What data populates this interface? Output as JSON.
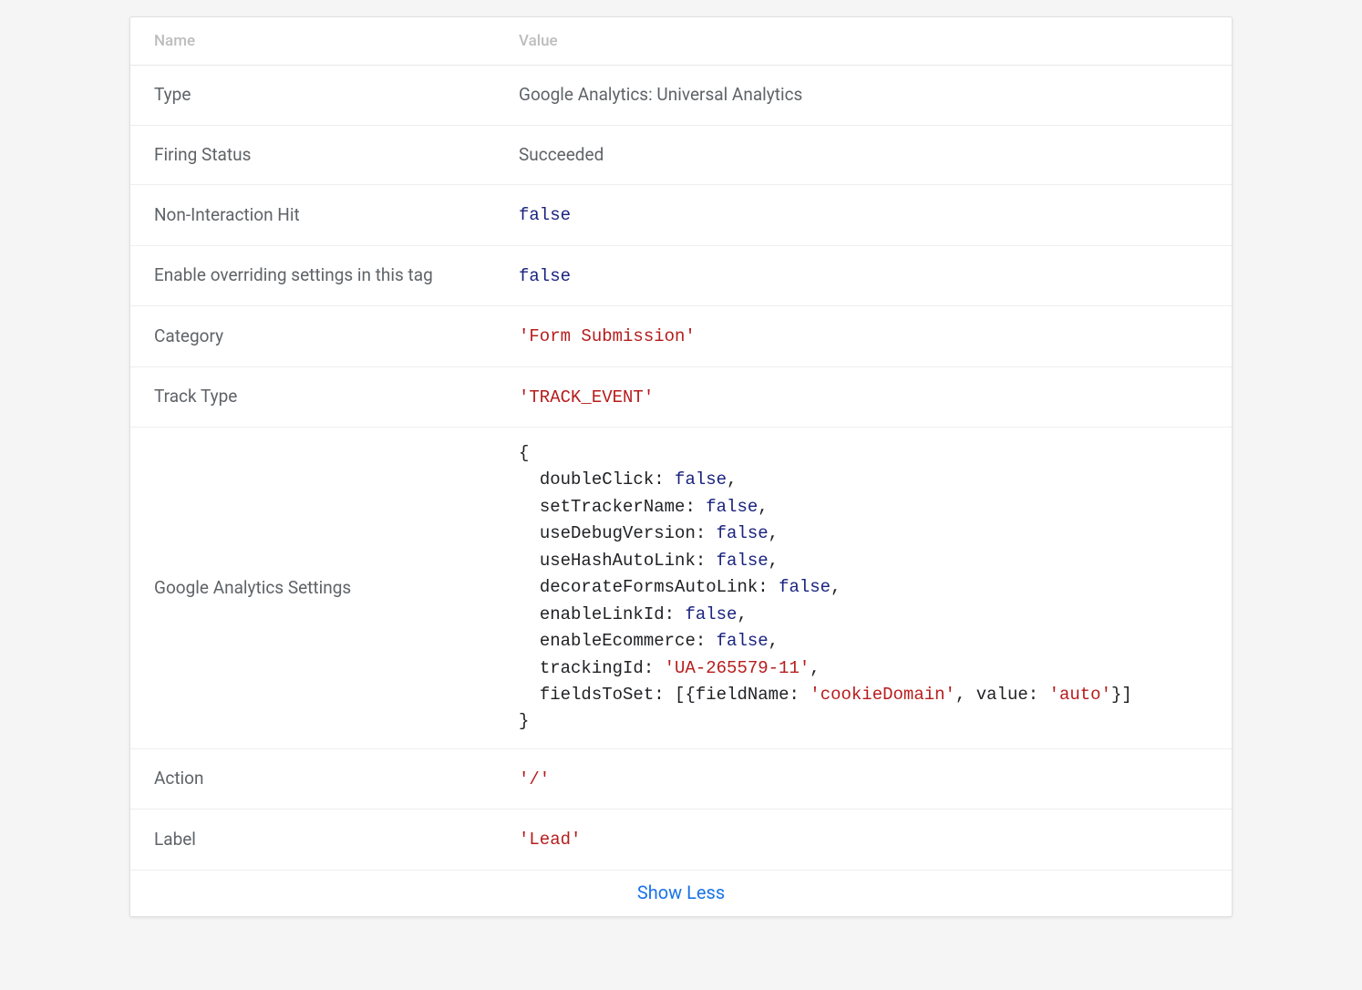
{
  "table": {
    "headers": {
      "name": "Name",
      "value": "Value"
    },
    "rows": {
      "type": {
        "name": "Type",
        "value": "Google Analytics: Universal Analytics",
        "kind": "plain"
      },
      "firingStatus": {
        "name": "Firing Status",
        "value": "Succeeded",
        "kind": "plain"
      },
      "nonInteraction": {
        "name": "Non-Interaction Hit",
        "value": "false",
        "kind": "kw"
      },
      "enableOverride": {
        "name": "Enable overriding settings in this tag",
        "value": "false",
        "kind": "kw"
      },
      "category": {
        "name": "Category",
        "value": "'Form Submission'",
        "kind": "str"
      },
      "trackType": {
        "name": "Track Type",
        "value": "'TRACK_EVENT'",
        "kind": "str"
      },
      "gaSettings": {
        "name": "Google Analytics Settings"
      },
      "action": {
        "name": "Action",
        "value": "'/'",
        "kind": "str"
      },
      "label": {
        "name": "Label",
        "value": "'Lead'",
        "kind": "str"
      }
    },
    "gaSettingsObject": {
      "doubleClick": "false",
      "setTrackerName": "false",
      "useDebugVersion": "false",
      "useHashAutoLink": "false",
      "decorateFormsAutoLink": "false",
      "enableLinkId": "false",
      "enableEcommerce": "false",
      "trackingId": "'UA-265579-11'",
      "fieldsToSet_fieldName": "'cookieDomain'",
      "fieldsToSet_value": "'auto'"
    }
  },
  "footer": {
    "showLess": "Show Less"
  }
}
